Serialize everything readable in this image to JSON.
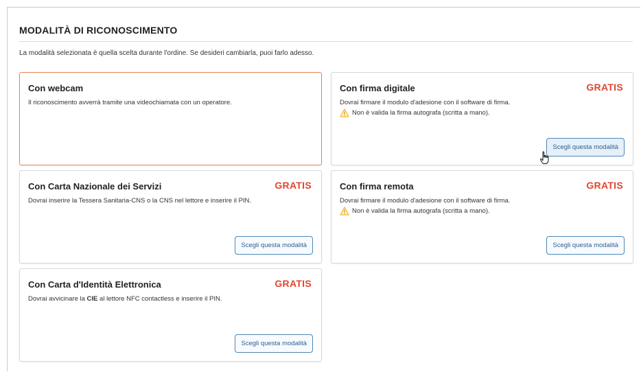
{
  "page": {
    "title": "MODALITÀ DI RICONOSCIMENTO",
    "intro": "La modalità selezionata è quella scelta durante l'ordine. Se desideri cambiarla, puoi farlo adesso."
  },
  "cards": [
    {
      "title": "Con webcam",
      "desc": "Il riconoscimento avverrà tramite una videochiamata con un operatore.",
      "selected": true
    },
    {
      "title": "Con firma digitale",
      "badge": "GRATIS",
      "desc": "Dovrai firmare il modulo d'adesione con il software di firma.",
      "warning": "Non è valida la firma autografa (scritta a mano).",
      "button": "Scegli questa modalità"
    },
    {
      "title": "Con Carta Nazionale dei Servizi",
      "badge": "GRATIS",
      "desc": "Dovrai inserire la Tessera Sanitaria-CNS o la CNS nel lettore e inserire il PIN.",
      "button": "Scegli questa modalità"
    },
    {
      "title": "Con firma remota",
      "badge": "GRATIS",
      "desc": "Dovrai firmare il modulo d'adesione con il software di firma.",
      "warning": "Non è valida la firma autografa (scritta a mano).",
      "button": "Scegli questa modalità"
    },
    {
      "title": "Con Carta d'Identità Elettronica",
      "badge": "GRATIS",
      "desc_before": "Dovrai avvicinare la ",
      "desc_bold": "CIE",
      "desc_after": " al lettore NFC contactless e inserire il PIN.",
      "button": "Scegli questa modalità"
    }
  ],
  "colors": {
    "accent_red": "#e0452e",
    "selected_border": "#e8814f",
    "button_border": "#4f86b5",
    "warning_yellow": "#f2b632"
  },
  "icons": {
    "warning": "warning-icon",
    "cursor": "hand-pointer-cursor-icon"
  }
}
